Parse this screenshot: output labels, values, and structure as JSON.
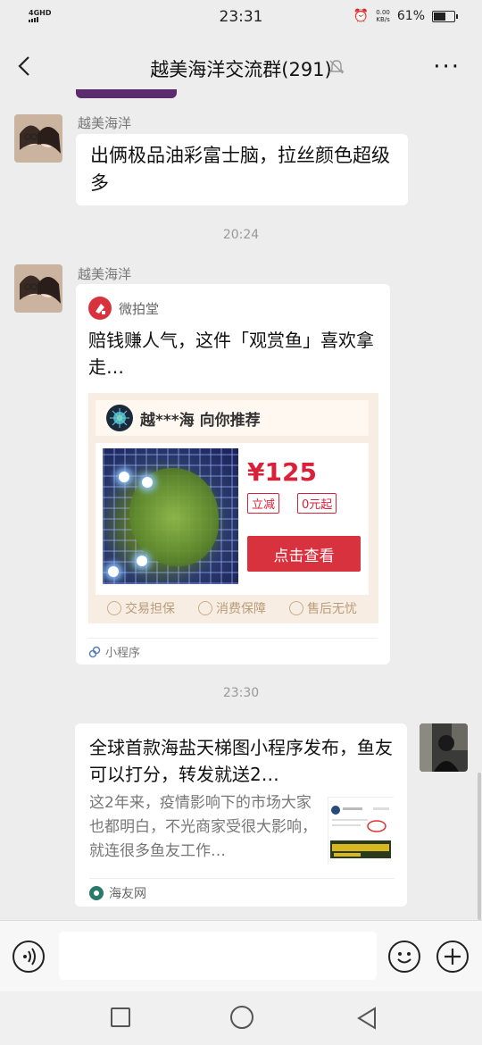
{
  "status_bar": {
    "network": "4GHD",
    "time": "23:31",
    "speed_value": "0.00",
    "speed_unit": "KB/s",
    "battery": "61%",
    "battery_level": 0.61
  },
  "header": {
    "title": "越美海洋交流群(291)"
  },
  "messages": {
    "m1": {
      "sender": "越美海洋",
      "text": "出俩极品油彩富士脑，拉丝颜色超级多"
    },
    "ts1": "20:24",
    "m2": {
      "sender": "越美海洋",
      "source": "微拍堂",
      "title": "赔钱赚人气，这件「观赏鱼」喜欢拿走…",
      "recommender": "越***海 向你推荐",
      "price": "¥125",
      "tag1": "立减",
      "tag2": "0元起",
      "button": "点击查看",
      "guarantee1": "交易担保",
      "guarantee2": "消费保障",
      "guarantee3": "售后无忧",
      "footer": "小程序"
    },
    "ts2": "23:30",
    "m3": {
      "title": "全球首款海盐天梯图小程序发布，鱼友可以打分，转发就送2…",
      "desc": "这2年来，疫情影响下的市场大家也都明白，不光商家受很大影响，就连很多鱼友工作…",
      "source": "海友网"
    }
  },
  "input": {
    "placeholder": ""
  },
  "colors": {
    "accent_red": "#d8323f",
    "bubble": "#ffffff",
    "background": "#ededed"
  },
  "icons": [
    "back-arrow-icon",
    "mute-bell-icon",
    "more-icon",
    "voice-icon",
    "emoji-icon",
    "plus-icon",
    "square-nav-icon",
    "home-circle-icon",
    "back-triangle-icon"
  ]
}
